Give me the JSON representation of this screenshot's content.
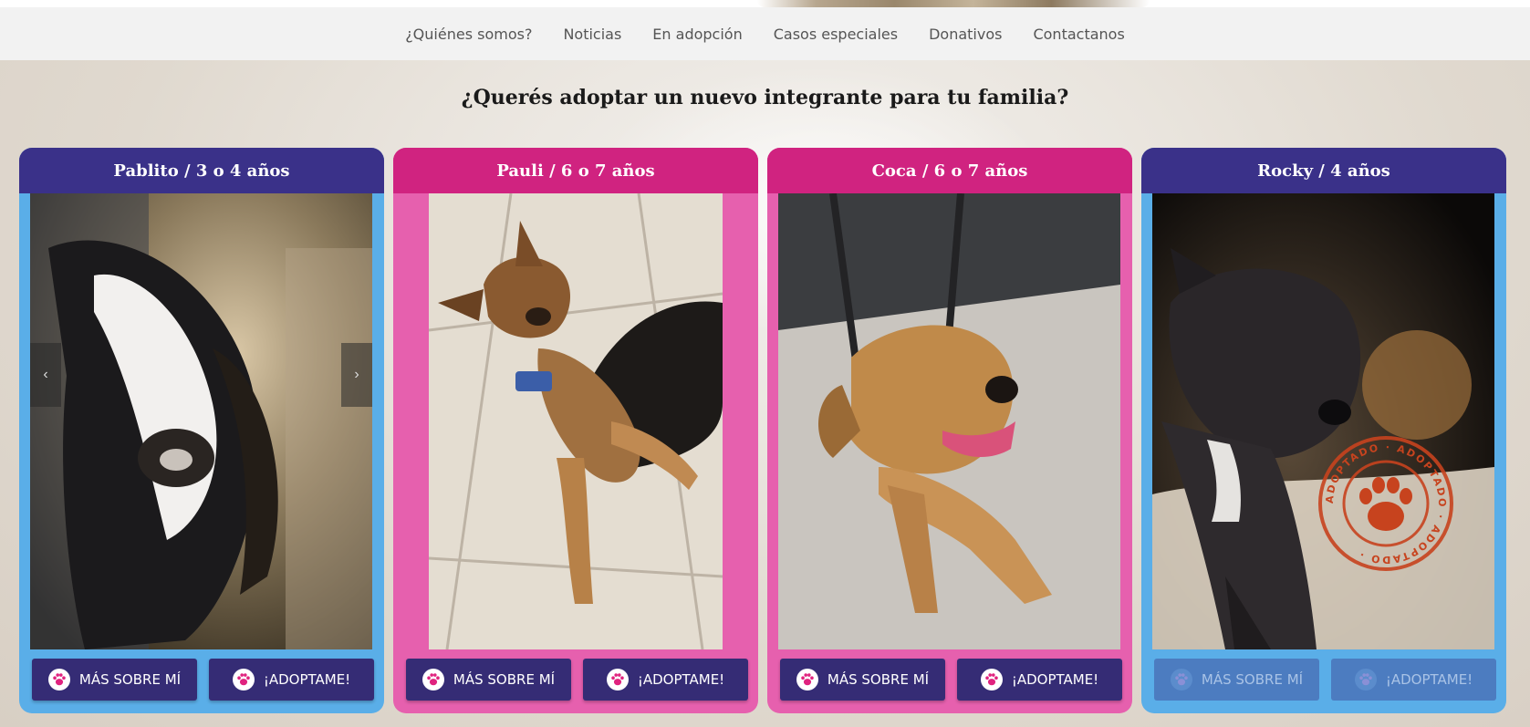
{
  "nav": {
    "items": [
      {
        "label": "¿Quiénes somos?"
      },
      {
        "label": "Noticias"
      },
      {
        "label": "En adopción"
      },
      {
        "label": "Casos especiales"
      },
      {
        "label": "Donativos"
      },
      {
        "label": "Contactanos"
      }
    ]
  },
  "headline": "¿Querés adoptar un nuevo integrante para tu familia?",
  "cards": [
    {
      "title": "Pablito / 3 o 4 años",
      "theme": "blue",
      "more_label": "MÁS SOBRE MÍ",
      "adopt_label": "¡ADOPTAME!",
      "prev_icon": "‹",
      "next_icon": "›"
    },
    {
      "title": "Pauli / 6 o 7 años",
      "theme": "pink",
      "more_label": "MÁS SOBRE MÍ",
      "adopt_label": "¡ADOPTAME!"
    },
    {
      "title": "Coca / 6 o 7 años",
      "theme": "pink",
      "more_label": "MÁS SOBRE MÍ",
      "adopt_label": "¡ADOPTAME!"
    },
    {
      "title": "Rocky / 4 años",
      "theme": "blue",
      "more_label": "MÁS SOBRE MÍ",
      "adopt_label": "¡ADOPTAME!",
      "stamp_text": "ADOPTADO · ADOPTADO · ADOPTADO ·"
    }
  ],
  "colors": {
    "blue_card": "#5aaee8",
    "blue_head": "#3a3189",
    "pink_card": "#e660ae",
    "pink_head": "#d02380",
    "button": "#352c75",
    "paw": "#e0237f"
  }
}
